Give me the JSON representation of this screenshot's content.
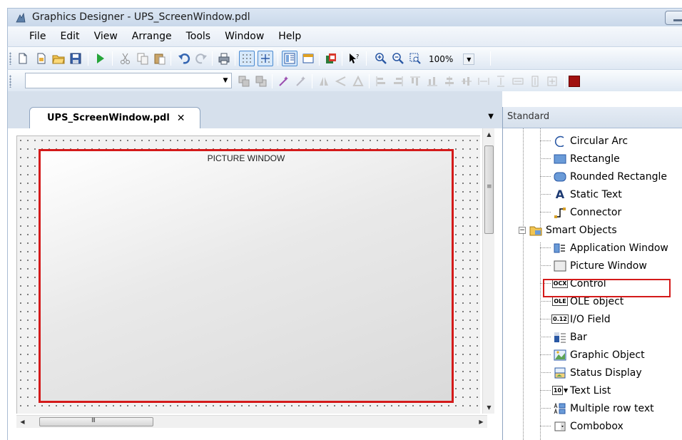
{
  "window": {
    "title": "Graphics Designer - UPS_ScreenWindow.pdl"
  },
  "menu": [
    "File",
    "Edit",
    "View",
    "Arrange",
    "Tools",
    "Window",
    "Help"
  ],
  "toolbar": {
    "zoom": "100%"
  },
  "document": {
    "tab_label": "UPS_ScreenWindow.pdl",
    "tab_close": "✕",
    "picture_window_label": "PICTURE WINDOW"
  },
  "panel": {
    "title": "Standard",
    "items_basic": [
      {
        "label": "Circular Arc",
        "icon": "circular-arc-icon"
      },
      {
        "label": "Rectangle",
        "icon": "rectangle-icon"
      },
      {
        "label": "Rounded Rectangle",
        "icon": "rounded-rectangle-icon"
      },
      {
        "label": "Static Text",
        "icon": "static-text-icon"
      },
      {
        "label": "Connector",
        "icon": "connector-icon"
      }
    ],
    "group_label": "Smart Objects",
    "items_smart": [
      {
        "label": "Application Window",
        "icon": "application-window-icon"
      },
      {
        "label": "Picture Window",
        "icon": "picture-window-icon"
      },
      {
        "label": "Control",
        "icon": "control-icon"
      },
      {
        "label": "OLE object",
        "icon": "ole-object-icon"
      },
      {
        "label": "I/O Field",
        "icon": "io-field-icon"
      },
      {
        "label": "Bar",
        "icon": "bar-icon"
      },
      {
        "label": "Graphic Object",
        "icon": "graphic-object-icon"
      },
      {
        "label": "Status Display",
        "icon": "status-display-icon"
      },
      {
        "label": "Text List",
        "icon": "text-list-icon"
      },
      {
        "label": "Multiple row text",
        "icon": "multiple-row-text-icon"
      },
      {
        "label": "Combobox",
        "icon": "combobox-icon"
      }
    ],
    "icon_text": {
      "static_text": "A",
      "control": "OCX",
      "ole": "OLE",
      "io": "0.12",
      "text_list": "10"
    }
  },
  "colors": {
    "highlight": "#d41a1a",
    "accent_red_swatch": "#a01010"
  }
}
